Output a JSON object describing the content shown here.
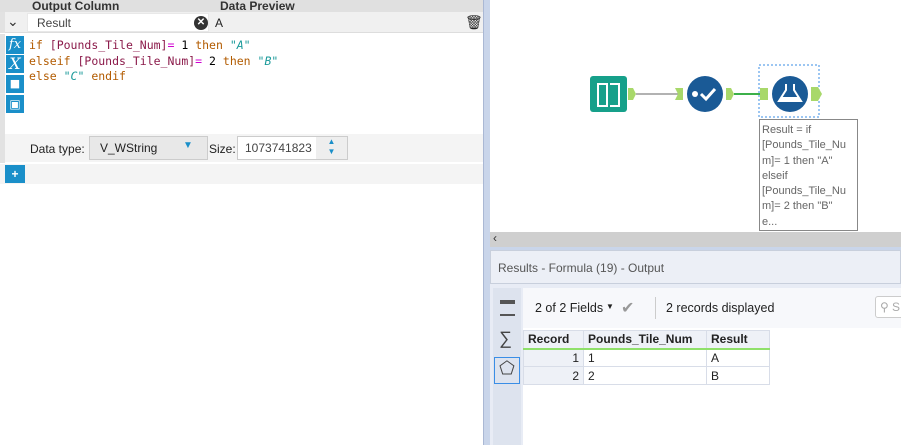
{
  "formula_panel": {
    "header": {
      "output_column": "Output Column",
      "data_preview": "Data Preview"
    },
    "row": {
      "output_column_value": "Result",
      "data_preview_value": "A"
    },
    "expression_lines": [
      [
        {
          "t": "if ",
          "c": "kw"
        },
        {
          "t": "[Pounds_Tile_Num]",
          "c": "fld"
        },
        {
          "t": "= ",
          "c": "op"
        },
        {
          "t": "1",
          "c": "num"
        },
        {
          "t": " then ",
          "c": "kw"
        },
        {
          "t": "\"A\"",
          "c": "str"
        }
      ],
      [
        {
          "t": "elseif ",
          "c": "kw"
        },
        {
          "t": "[Pounds_Tile_Num]",
          "c": "fld"
        },
        {
          "t": "= ",
          "c": "op"
        },
        {
          "t": "2",
          "c": "num"
        },
        {
          "t": " then ",
          "c": "kw"
        },
        {
          "t": "\"B\"",
          "c": "str"
        }
      ],
      [
        {
          "t": "else ",
          "c": "kw"
        },
        {
          "t": "\"C\"",
          "c": "str"
        },
        {
          "t": " endif",
          "c": "kw"
        }
      ]
    ],
    "data_type_label": "Data type:",
    "data_type_value": "V_WString",
    "size_label": "Size:",
    "size_value": "1073741823",
    "icons": {
      "function": "fx",
      "variable": "X"
    }
  },
  "canvas": {
    "tooltip_lines": [
      "Result = if",
      "[Pounds_Tile_Nu",
      "m]= 1 then \"A\"",
      "elseif",
      "[Pounds_Tile_Nu",
      "m]= 2 then \"B\"",
      "e..."
    ],
    "colors": {
      "input": "#16a08a",
      "tool": "#1a5a96",
      "anchor": "#a8d86a",
      "connection_active": "#3cb04a"
    }
  },
  "results": {
    "title": "Results - Formula (19) - Output",
    "fields_selector": "2 of 2 Fields",
    "records_displayed": "2 records displayed",
    "search_placeholder": "S",
    "columns": [
      "Record",
      "Pounds_Tile_Num",
      "Result"
    ],
    "rows": [
      [
        "1",
        "1",
        "A"
      ],
      [
        "2",
        "2",
        "B"
      ]
    ]
  }
}
